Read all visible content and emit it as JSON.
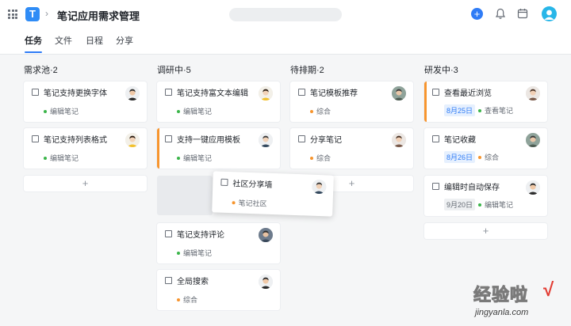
{
  "header": {
    "logo_letter": "T",
    "project_title": "笔记应用需求管理",
    "add_symbol": "+"
  },
  "tabs": [
    "任务",
    "文件",
    "日程",
    "分享"
  ],
  "columns": [
    {
      "title": "需求池·2",
      "cards": [
        {
          "title": "笔记支持更换字体",
          "tag": "编辑笔记",
          "tag_color": "#3bb54a",
          "avatar": "man"
        },
        {
          "title": "笔记支持列表格式",
          "tag": "编辑笔记",
          "tag_color": "#3bb54a",
          "avatar": "woman"
        }
      ],
      "add_label": "+"
    },
    {
      "title": "调研中·5",
      "cards": [
        {
          "title": "笔记支持富文本编辑",
          "tag": "编辑笔记",
          "tag_color": "#3bb54a",
          "avatar": "woman"
        },
        {
          "title": "支持一键应用模板",
          "tag": "编辑笔记",
          "tag_color": "#3bb54a",
          "avatar": "man2"
        },
        {
          "title": "笔记支持评论",
          "tag": "编辑笔记",
          "tag_color": "#3bb54a",
          "avatar": "man3"
        },
        {
          "title": "全局搜索",
          "tag": "综合",
          "tag_color": "#f7952e",
          "avatar": "man"
        }
      ],
      "dragging": {
        "title": "社区分享墙",
        "tag": "笔记社区",
        "tag_color": "#f7952e",
        "avatar": "man2"
      }
    },
    {
      "title": "待排期·2",
      "cards": [
        {
          "title": "笔记模板推荐",
          "tag": "综合",
          "tag_color": "#f7952e",
          "avatar": "man4"
        },
        {
          "title": "分享笔记",
          "tag": "综合",
          "tag_color": "#f7952e",
          "avatar": "woman2"
        }
      ],
      "add_label": "+"
    },
    {
      "title": "研发中·3",
      "cards": [
        {
          "title": "查看最近浏览",
          "date": "8月25日",
          "date_style": "blue",
          "tag": "查看笔记",
          "tag_color": "#3bb54a",
          "avatar": "woman2"
        },
        {
          "title": "笔记收藏",
          "date": "8月26日",
          "date_style": "blue",
          "tag": "综合",
          "tag_color": "#f7952e",
          "avatar": "man4"
        },
        {
          "title": "编辑时自动保存",
          "date": "9月20日",
          "date_style": "gray",
          "tag": "编辑笔记",
          "tag_color": "#3bb54a",
          "avatar": "man"
        }
      ],
      "add_label": "+"
    }
  ],
  "watermark": {
    "cn": "经验啦",
    "en": "jingyanla.com",
    "check": "√"
  }
}
